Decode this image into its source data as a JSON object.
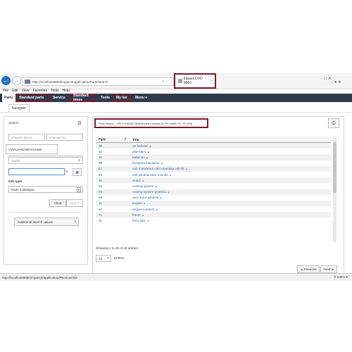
{
  "browser": {
    "url": "http://localhost8880/impact3/application/Parts/search",
    "address_controls": "⌕ − →",
    "tab_title": "Impact DVD 8883",
    "window_controls": "− □ ✕",
    "toolbar_icons": "⌂ ★ ⚙",
    "menu": [
      "File",
      "Edit",
      "View",
      "Favorites",
      "Tools",
      "Help"
    ]
  },
  "nav": {
    "items": [
      "Parts",
      "Standard parts",
      "Service",
      "Standard times",
      "Tools",
      "My list",
      "Menu ▾"
    ],
    "subnav": "Navigate"
  },
  "left": {
    "search_label": "Search",
    "chassis_series_placeholder": "Chassis series",
    "chassis_no_placeholder": "Chassis No",
    "vin_value": "YV2A2A5C5DA044466",
    "model_placeholder": "Model",
    "info_type_label": "Info type",
    "info_type_value": "Parts Catalogue",
    "clear_label": "Clear",
    "search_label_btn": "Search",
    "additional_label": "Additional search values"
  },
  "right": {
    "search_info": "Parts Search - VIN YV2A2A5C5DA044466 (Chassis ID FH 44466, FH, FH 520)",
    "print_icon": "print-icon",
    "table": {
      "headers": [
        "Fgrp",
        "Title"
      ],
      "rows": [
        {
          "code": "36",
          "title": "Air bellows"
        },
        {
          "code": "32",
          "title": "alternator"
        },
        {
          "code": "31",
          "title": "batteries"
        },
        {
          "code": "86",
          "title": "bumpers insulation"
        },
        {
          "code": "81",
          "title": "cab framework cab mounting cab tilt"
        },
        {
          "code": "83",
          "title": "cab window door minnde"
        },
        {
          "code": "41",
          "title": "clutch"
        },
        {
          "code": "26",
          "title": "cooling system"
        },
        {
          "code": "49",
          "title": "cooling system gearbox"
        },
        {
          "code": "85",
          "title": "door Door window"
        },
        {
          "code": "21",
          "title": "engine"
        },
        {
          "code": "27",
          "title": "engine controls"
        },
        {
          "code": "71",
          "title": "frame"
        },
        {
          "code": "61",
          "title": "front axle"
        }
      ]
    },
    "showing": "Showing 1 to 25 of 42 entries",
    "page_size": "25",
    "entries_label": "Entries",
    "previous": "Previous",
    "next": "Next"
  },
  "status": {
    "url": "http://localhost8880/impact3/application/PreviousTab",
    "zoom": "100%"
  }
}
